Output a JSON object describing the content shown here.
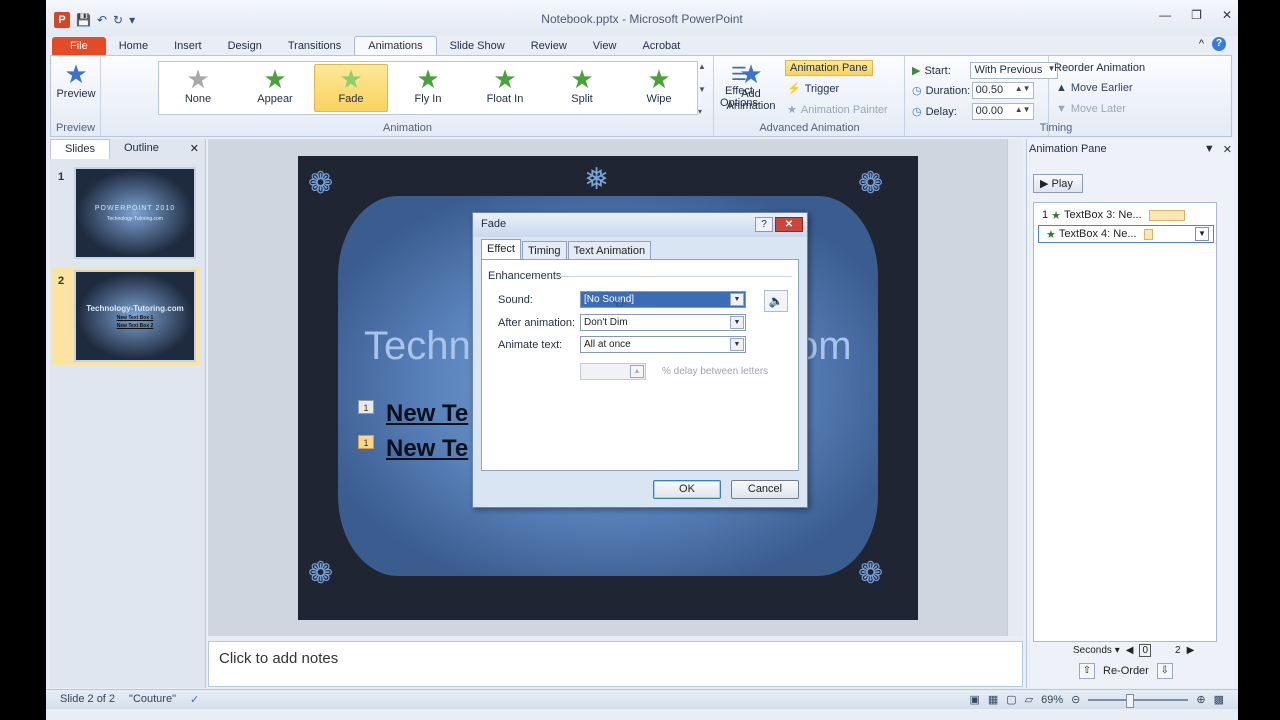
{
  "window": {
    "title": "Notebook.pptx - Microsoft PowerPoint"
  },
  "ribbon_tabs": [
    "File",
    "Home",
    "Insert",
    "Design",
    "Transitions",
    "Animations",
    "Slide Show",
    "Review",
    "View",
    "Acrobat"
  ],
  "ribbon": {
    "preview": {
      "label": "Preview",
      "group": "Preview"
    },
    "animations": [
      "None",
      "Appear",
      "Fade",
      "Fly In",
      "Float In",
      "Split",
      "Wipe"
    ],
    "selected_animation": "Fade",
    "effect_options": [
      "Effect",
      "Options"
    ],
    "animation_group": "Animation",
    "add_animation": [
      "Add",
      "Animation"
    ],
    "animation_pane": "Animation Pane",
    "trigger": "Trigger",
    "animation_painter": "Animation Painter",
    "advanced_group": "Advanced Animation",
    "start_label": "Start:",
    "start_value": "With Previous",
    "duration_label": "Duration:",
    "duration_value": "00.50",
    "delay_label": "Delay:",
    "delay_value": "00.00",
    "timing_group": "Timing",
    "reorder_title": "Reorder Animation",
    "move_earlier": "Move Earlier",
    "move_later": "Move Later"
  },
  "slides_panel": {
    "tabs": [
      "Slides",
      "Outline"
    ],
    "thumbs": [
      {
        "num": "1",
        "line1": "POWERPOINT 2010",
        "line2": "Technology-Tutoring.com"
      },
      {
        "num": "2",
        "line1": "Technology-Tutoring.com",
        "bullets": [
          "New Text Box 1",
          "New Text Box 2"
        ]
      }
    ]
  },
  "slide": {
    "title_left": "Techn",
    "title_right": "om",
    "bullets": [
      "New Te",
      "New Te"
    ],
    "anim_tags": [
      "1",
      "1"
    ]
  },
  "notes": {
    "placeholder": "Click to add notes"
  },
  "anim_pane": {
    "title": "Animation Pane",
    "play": "Play",
    "items": [
      {
        "order": "1",
        "label": "TextBox 3: Ne..."
      },
      {
        "order": "",
        "label": "TextBox 4: Ne..."
      }
    ],
    "seconds": "Seconds",
    "scale_start": "0",
    "scale_end": "2",
    "reorder": "Re-Order"
  },
  "status": {
    "slide": "Slide 2 of 2",
    "theme": "\"Couture\"",
    "zoom": "69%"
  },
  "dialog": {
    "title": "Fade",
    "tabs": [
      "Effect",
      "Timing",
      "Text Animation"
    ],
    "section": "Enhancements",
    "sound_label": "Sound:",
    "sound_value": "[No Sound]",
    "after_label": "After animation:",
    "after_value": "Don't Dim",
    "animate_label": "Animate text:",
    "animate_value": "All at once",
    "delay_label": "% delay between letters",
    "ok": "OK",
    "cancel": "Cancel"
  },
  "colors": {
    "accent_file": "#e34a25",
    "selected_gallery": "#f9d25c",
    "slide_blue": "#5b84bd"
  }
}
